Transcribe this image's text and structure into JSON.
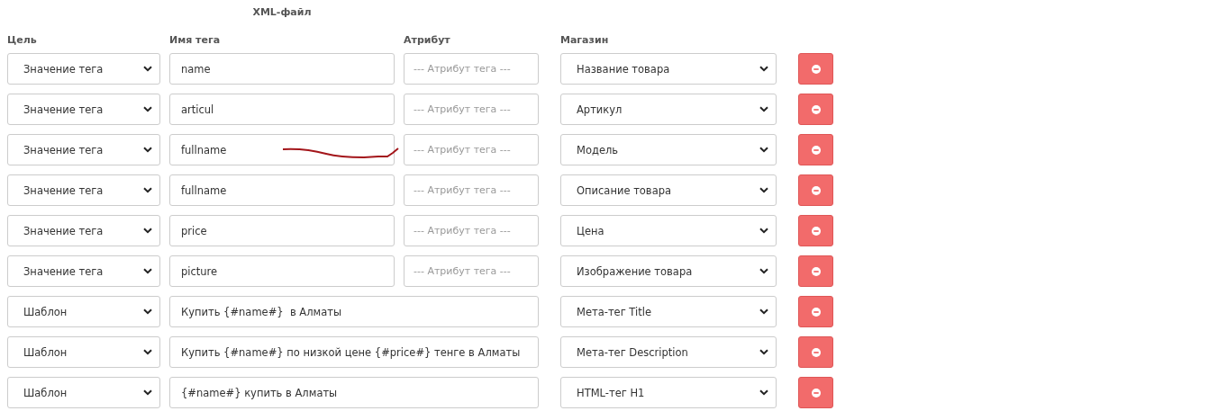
{
  "group_title": "XML-файл",
  "columns": [
    "Цель",
    "Имя тега",
    "Атрибут",
    "Магазин"
  ],
  "rows": [
    {
      "kind": "tag",
      "target": "Значение тега",
      "tag": "name",
      "attribute_placeholder": "--- Атрибут тега ---",
      "shop": "Название товара",
      "scribbled": false
    },
    {
      "kind": "tag",
      "target": "Значение тега",
      "tag": "articul",
      "attribute_placeholder": "--- Атрибут тега ---",
      "shop": "Артикул",
      "scribbled": false
    },
    {
      "kind": "tag",
      "target": "Значение тега",
      "tag": "fullname",
      "attribute_placeholder": "--- Атрибут тега ---",
      "shop": "Модель",
      "scribbled": true
    },
    {
      "kind": "tag",
      "target": "Значение тега",
      "tag": "fullname",
      "attribute_placeholder": "--- Атрибут тега ---",
      "shop": "Описание товара",
      "scribbled": false
    },
    {
      "kind": "tag",
      "target": "Значение тега",
      "tag": "price",
      "attribute_placeholder": "--- Атрибут тега ---",
      "shop": "Цена",
      "scribbled": false
    },
    {
      "kind": "tag",
      "target": "Значение тега",
      "tag": "picture",
      "attribute_placeholder": "--- Атрибут тега ---",
      "shop": "Изображение товара",
      "scribbled": false
    },
    {
      "kind": "template",
      "target": "Шаблон",
      "template": "Купить {#name#}  в Алматы",
      "shop": "Мета-тег Title",
      "scribbled": false
    },
    {
      "kind": "template",
      "target": "Шаблон",
      "template": "Купить {#name#} по низкой цене {#price#} тенге в Алматы",
      "shop": "Мета-тег Description",
      "scribbled": false
    },
    {
      "kind": "template",
      "target": "Шаблон",
      "template": "{#name#} купить в Алматы",
      "shop": "HTML-тег H1",
      "scribbled": false
    }
  ]
}
